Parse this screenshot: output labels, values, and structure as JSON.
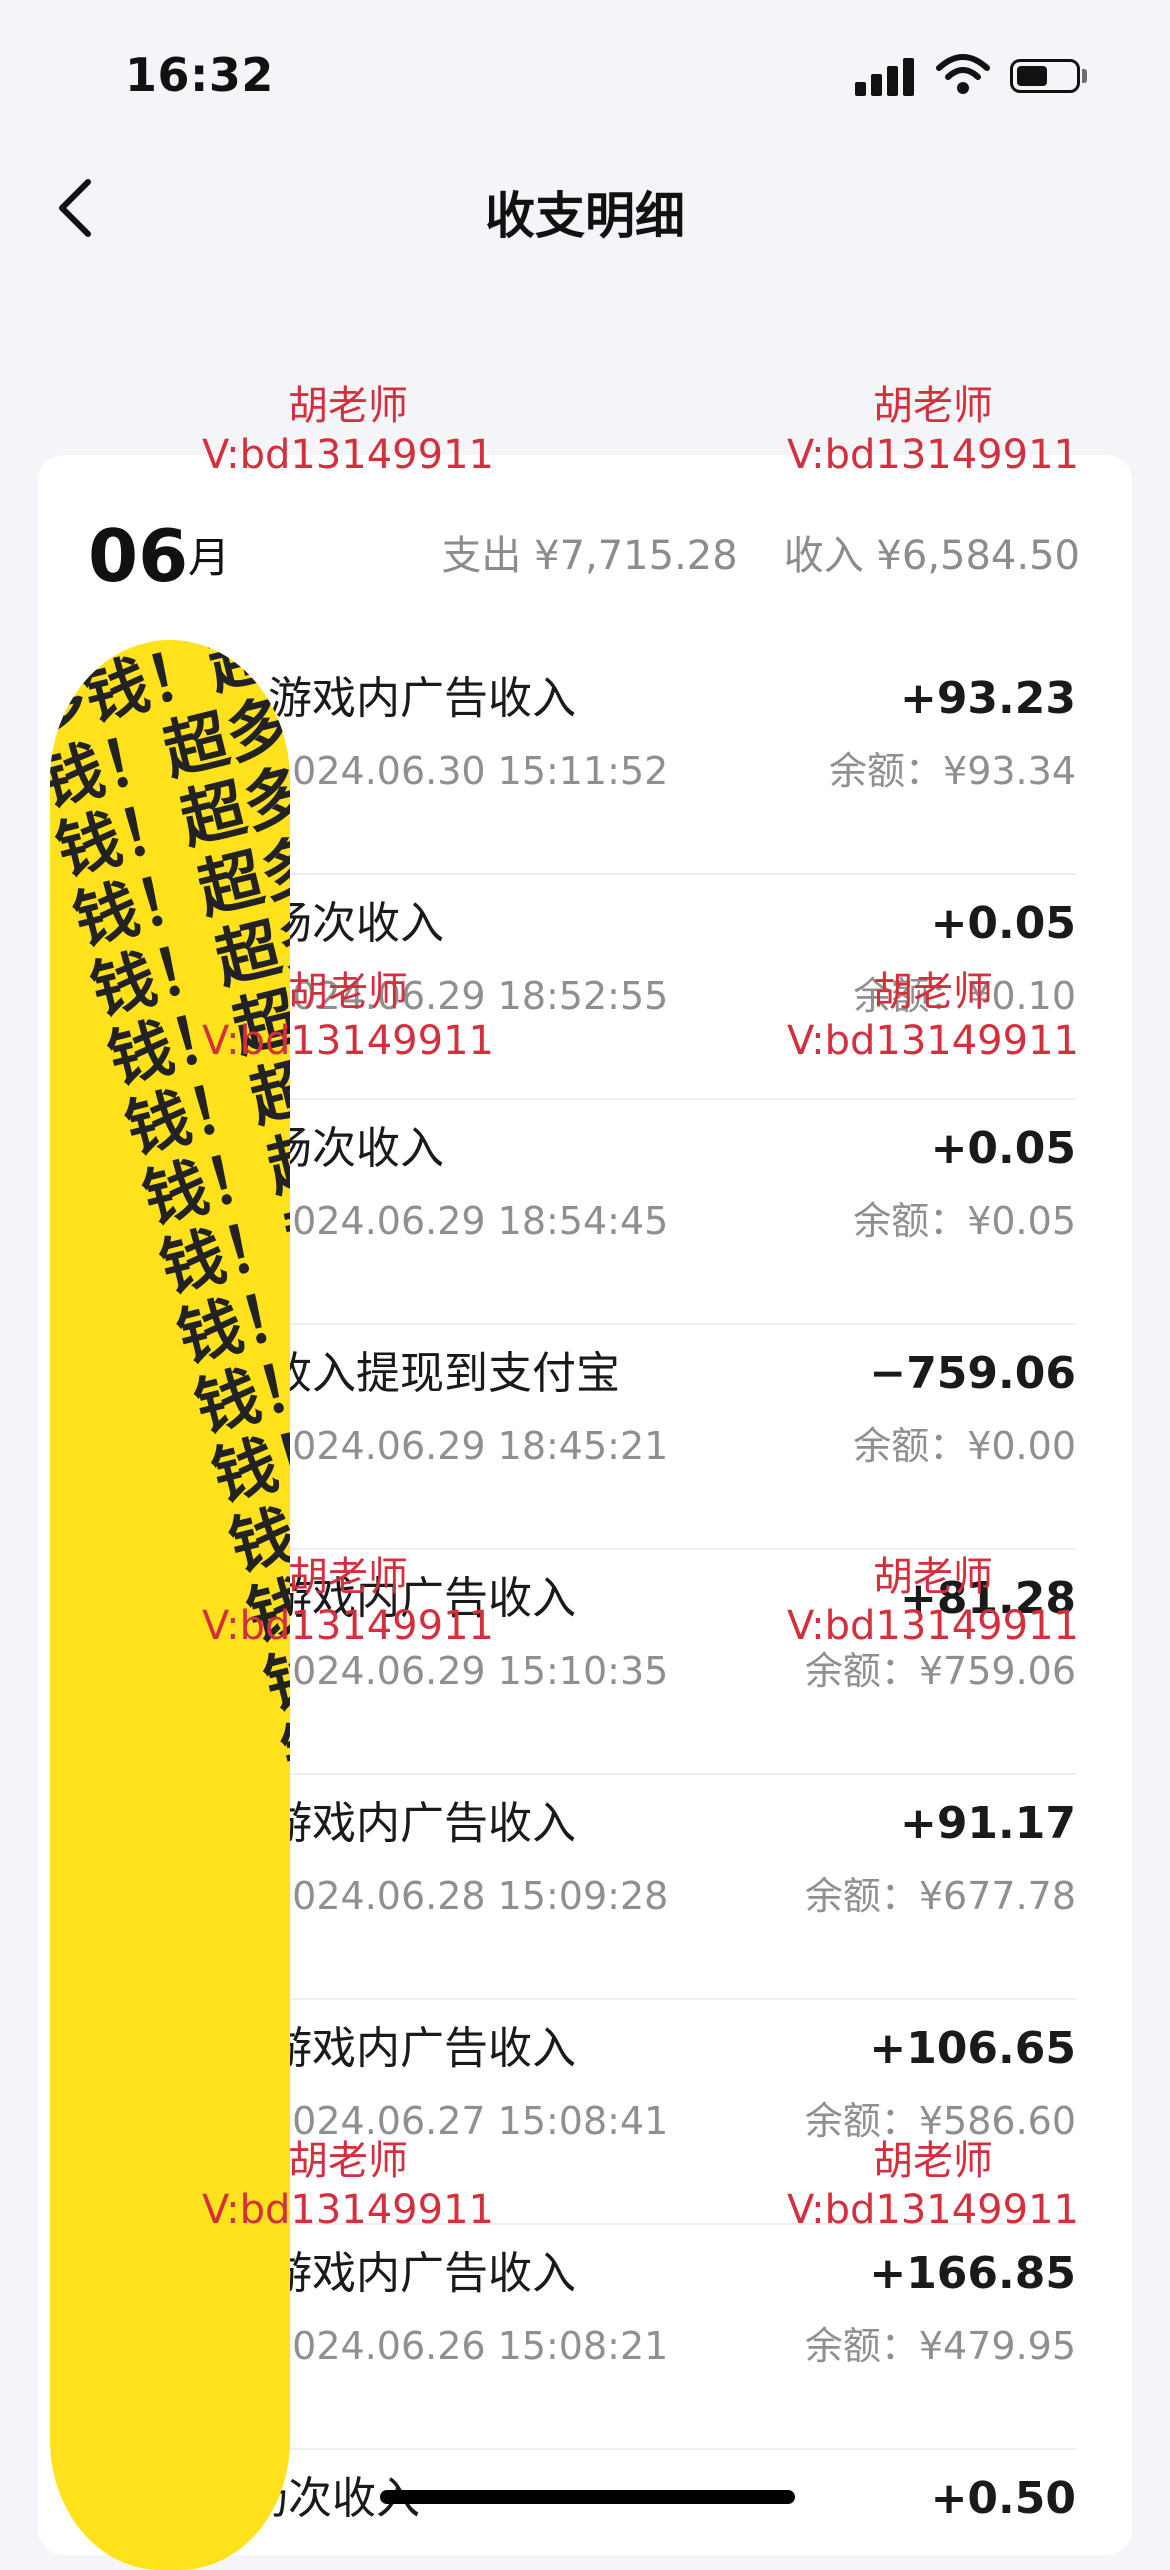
{
  "status_bar": {
    "time": "16:32"
  },
  "header": {
    "title": "收支明细"
  },
  "month_header": {
    "month": "06",
    "month_unit": "月",
    "expense": "支出 ¥7,715.28",
    "income": "收入 ¥6,584.50"
  },
  "transactions": [
    {
      "title": "游戏内广告收入",
      "time": "2024.06.30 15:11:52",
      "amount": "+93.23",
      "balance": "余额：¥93.34"
    },
    {
      "title": "场次收入",
      "time": "2024.06.29 18:52:55",
      "amount": "+0.05",
      "balance": "余额：¥0.10"
    },
    {
      "title": "场次收入",
      "time": "2024.06.29 18:54:45",
      "amount": "+0.05",
      "balance": "余额：¥0.05"
    },
    {
      "title": "收入提现到支付宝",
      "time": "2024.06.29 18:45:21",
      "amount": "−759.06",
      "balance": "余额：¥0.00"
    },
    {
      "title": "游戏内广告收入",
      "time": "2024.06.29 15:10:35",
      "amount": "+81.28",
      "balance": "余额：¥759.06"
    },
    {
      "title": "游戏内广告收入",
      "time": "2024.06.28 15:09:28",
      "amount": "+91.17",
      "balance": "余额：¥677.78"
    },
    {
      "title": "游戏内广告收入",
      "time": "2024.06.27 15:08:41",
      "amount": "+106.65",
      "balance": "余额：¥586.60"
    },
    {
      "title": "游戏内广告收入",
      "time": "2024.06.26 15:08:21",
      "amount": "+166.85",
      "balance": "余额：¥479.95"
    },
    {
      "title": "拉新场次收入",
      "time": "",
      "amount": "+0.50",
      "balance": ""
    }
  ],
  "watermark": {
    "name": "胡老师",
    "contact": "V:bd13149911"
  },
  "sticker": {
    "text": "多钱！超多钱！超多钱！超多钱！超多钱！超多钱！超多钱！超多钱！超多钱！超多钱！超多钱！超多钱！超多钱！超多钱！超多钱！超多钱！超多钱！超多钱！超多钱！超多钱！超多钱！超多钱！超多钱！超多钱！超"
  },
  "icons": {
    "back": "chevron-left-icon",
    "transaction": "yen-coin-icon",
    "signal": "signal-icon",
    "wifi": "wifi-icon",
    "battery": "battery-icon"
  },
  "colors": {
    "background": "#f4f5f9",
    "card": "#ffffff",
    "watermark": "#d42f3c",
    "sticker": "#ffe21c",
    "secondary_text": "#8f8f8f"
  }
}
